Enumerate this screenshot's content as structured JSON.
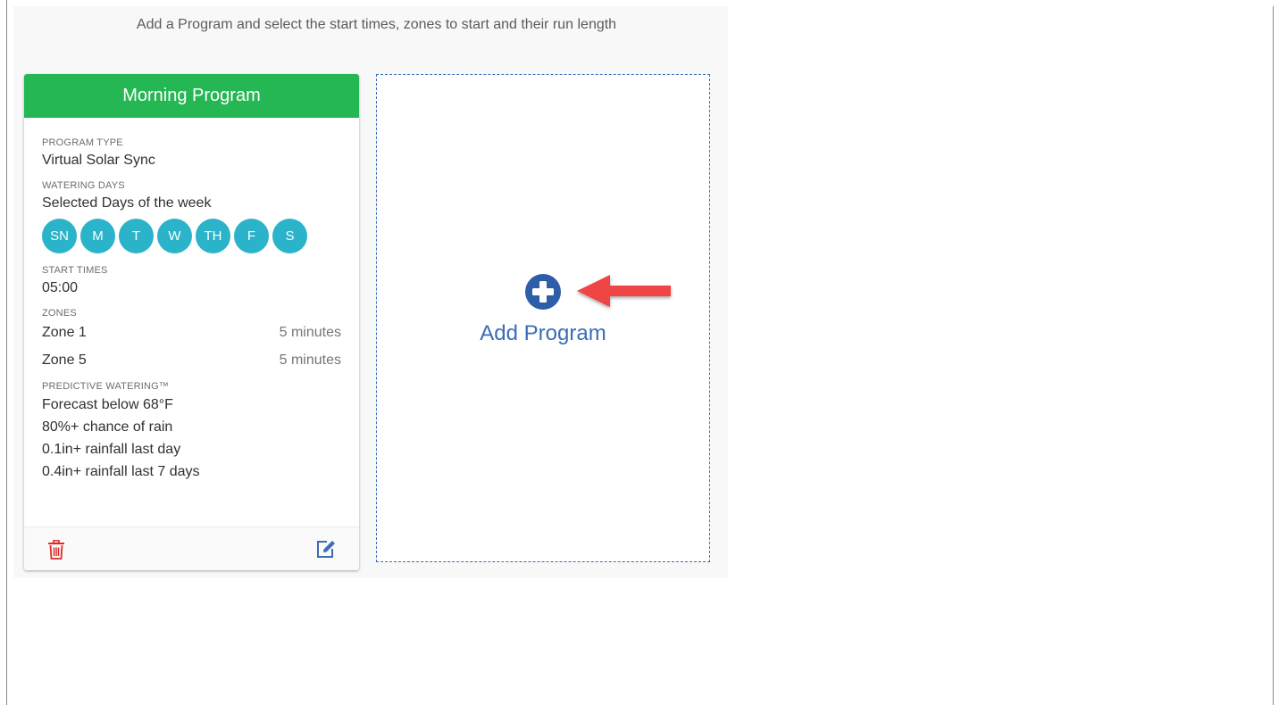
{
  "page": {
    "subtitle": "Add a Program and select the start times, zones to start and their run length"
  },
  "program_card": {
    "title": "Morning Program",
    "program_type_label": "PROGRAM TYPE",
    "program_type_value": "Virtual Solar Sync",
    "watering_days_label": "WATERING DAYS",
    "watering_days_value": "Selected Days of the week",
    "days": [
      "SN",
      "M",
      "T",
      "W",
      "TH",
      "F",
      "S"
    ],
    "start_times_label": "START TIMES",
    "start_time": "05:00",
    "zones_label": "ZONES",
    "zones": [
      {
        "name": "Zone 1",
        "duration": "5 minutes"
      },
      {
        "name": "Zone 5",
        "duration": "5 minutes"
      }
    ],
    "predictive_label": "PREDICTIVE WATERING™",
    "predictive_rules": [
      "Forecast below 68°F",
      "80%+ chance of rain",
      "0.1in+ rainfall last day",
      "0.4in+ rainfall last 7 days"
    ],
    "footer_icons": [
      "trash-icon",
      "edit-icon"
    ]
  },
  "add_program": {
    "label": "Add Program",
    "icon": "plus-circle-icon"
  },
  "annotation": {
    "icon": "red-arrow-icon"
  },
  "colors": {
    "header_green": "#25b753",
    "day_teal": "#2ab3c9",
    "accent_blue": "#3a6db5",
    "delete_red": "#e02b2b",
    "arrow_red": "#ef4444"
  }
}
